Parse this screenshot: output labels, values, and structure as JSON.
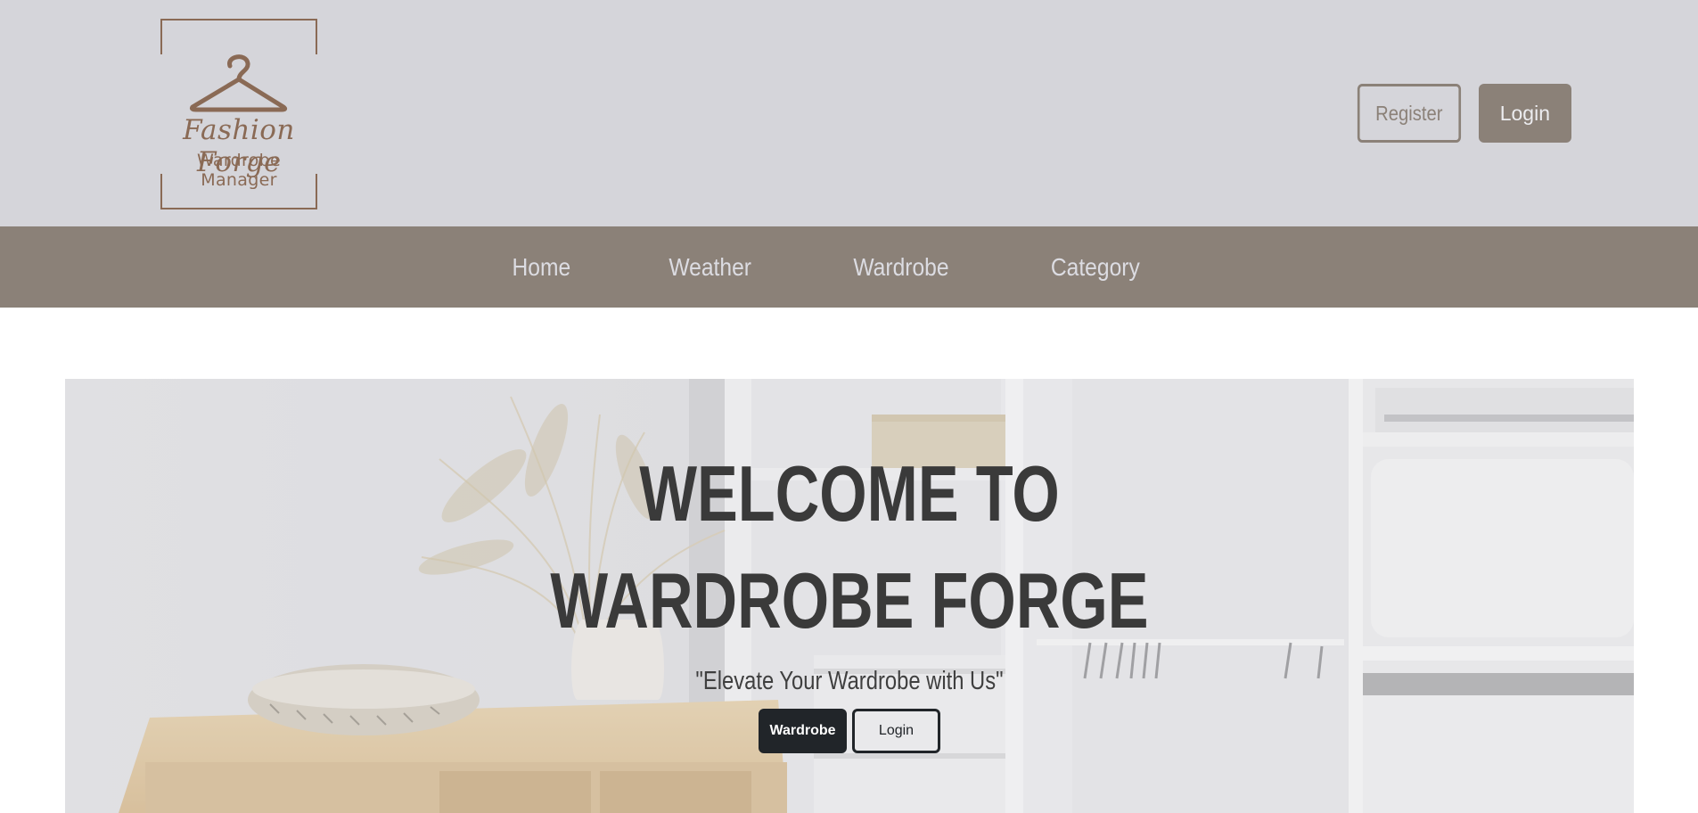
{
  "brand": {
    "name": "Fashion Forge",
    "tagline": "Wardrobe Manager",
    "logo_icon": "hanger-icon",
    "color": "#8a6a55"
  },
  "header": {
    "register_label": "Register",
    "login_label": "Login"
  },
  "nav": {
    "items": [
      {
        "label": "Home"
      },
      {
        "label": "Weather"
      },
      {
        "label": "Wardrobe"
      },
      {
        "label": "Category"
      }
    ]
  },
  "hero": {
    "title_line1": "WELCOME TO",
    "title_line2": "WARDROBE FORGE",
    "tagline": "\"Elevate Your Wardrobe with Us\"",
    "primary_button": "Wardrobe",
    "secondary_button": "Login"
  },
  "colors": {
    "header_bg": "#d5d5da",
    "accent": "#8b8178",
    "dark_button": "#212529"
  }
}
